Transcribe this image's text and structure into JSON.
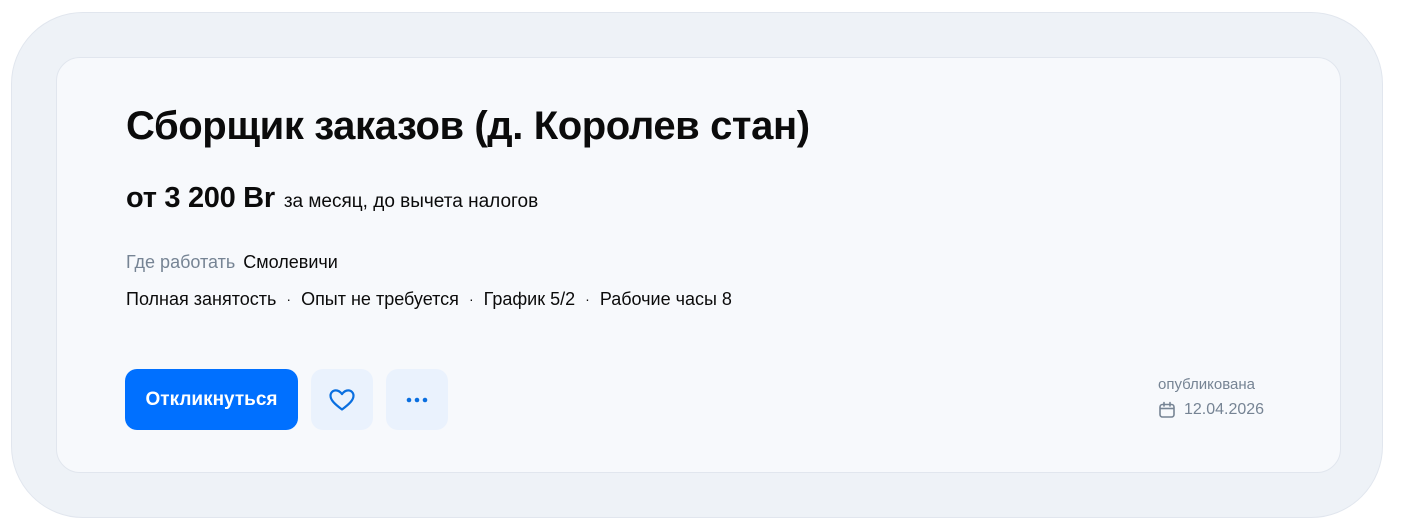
{
  "vacancy": {
    "title": "Сборщик заказов (д. Королев стан)",
    "salary_amount": "от 3 200 Br",
    "salary_note": "за месяц, до вычета налогов",
    "location_label": "Где работать",
    "location_value": "Смолевичи",
    "tags": [
      "Полная занятость",
      "Опыт не требуется",
      "График 5/2",
      "Рабочие часы 8"
    ],
    "separator": "·"
  },
  "actions": {
    "apply_label": "Откликнуться",
    "favorite_icon": "heart-icon",
    "more_icon": "more-dots-icon"
  },
  "published": {
    "label": "опубликована",
    "date": "12.04.2026",
    "icon": "calendar-icon"
  },
  "colors": {
    "accent": "#0070ff",
    "muted_text": "#768494",
    "icon_button_bg": "#eaf2fd"
  }
}
